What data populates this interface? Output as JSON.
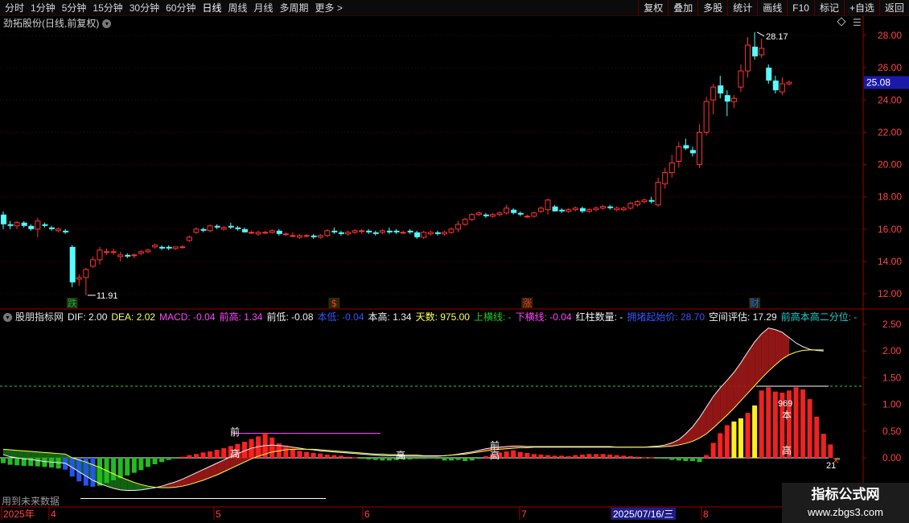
{
  "toolbar": {
    "periods": [
      "分时",
      "1分钟",
      "5分钟",
      "15分钟",
      "30分钟",
      "60分钟",
      "日线",
      "周线",
      "月线",
      "多周期",
      "更多 >"
    ],
    "active_period": "日线",
    "buttons": [
      "复权",
      "叠加",
      "多股",
      "统计",
      "画线",
      "F10",
      "标记",
      "+自选",
      "返回"
    ]
  },
  "stock": {
    "title": "劲拓股份(日线,前复权)"
  },
  "price_axis": {
    "labels": [
      "28.00",
      "26.00",
      "24.00",
      "22.00",
      "20.00",
      "18.00",
      "16.00",
      "14.00",
      "12.00"
    ],
    "current_price": "25.08",
    "high_label": "28.17",
    "low_label": "11.91"
  },
  "event_markers": [
    {
      "text": "跌",
      "color": "#00b050"
    },
    {
      "text": "$",
      "color": "#ff3030"
    },
    {
      "text": "涨",
      "color": "#ff3030"
    },
    {
      "text": "财",
      "color": "#2266ff"
    }
  ],
  "indicator": {
    "items": [
      {
        "text": "股朋指标网",
        "color": "#e0e0e0"
      },
      {
        "text": "DIF: 2.00",
        "color": "#f0f0f0"
      },
      {
        "text": "DEA: 2.02",
        "color": "#ffff55"
      },
      {
        "text": "MACD: -0.04",
        "color": "#ff44ff"
      },
      {
        "text": "前高: 1.34",
        "color": "#ff44ff"
      },
      {
        "text": "前低: -0.08",
        "color": "#f0f0f0"
      },
      {
        "text": "本低: -0.04",
        "color": "#3355ff"
      },
      {
        "text": "本高: 1.34",
        "color": "#f0f0f0"
      },
      {
        "text": "天数: 975.00",
        "color": "#ffff55"
      },
      {
        "text": "上横线: -",
        "color": "#22cc22"
      },
      {
        "text": "下横线: -0.04",
        "color": "#ff44ff"
      },
      {
        "text": "红柱数量: -",
        "color": "#f0f0f0"
      },
      {
        "text": "拥堵起始价: 28.70",
        "color": "#3355ff"
      },
      {
        "text": "空间评估: 17.29",
        "color": "#f0f0f0"
      },
      {
        "text": "前高本高二分位: -",
        "color": "#22cccc"
      }
    ],
    "axis_labels": [
      "2.50",
      "2.00",
      "1.50",
      "1.00",
      "0.50",
      "0.00"
    ],
    "annotations": {
      "qian": "前",
      "gao": "高",
      "ben": "本",
      "value_969": "969",
      "value_21": "21"
    }
  },
  "future_note": "用到未来数据",
  "date_axis": {
    "labels": [
      "2025年",
      "4",
      "5",
      "6",
      "7",
      "2025/07/16/三",
      "8"
    ]
  },
  "watermark": {
    "name": "指标公式网",
    "url": "www.zbgs3.com"
  },
  "colors": {
    "up": "#ff3333",
    "down": "#54ffff",
    "grid": "#5a0000",
    "axis": "#a00000"
  },
  "chart_data": {
    "type": "candlestick",
    "price_range": [
      11.5,
      28.8
    ],
    "candles": [
      [
        16.9,
        17.1,
        16.0,
        16.3
      ],
      [
        16.3,
        16.5,
        16.0,
        16.2
      ],
      [
        16.2,
        16.5,
        16.0,
        16.4
      ],
      [
        16.4,
        16.5,
        16.1,
        16.2
      ],
      [
        16.2,
        16.3,
        15.9,
        16.0
      ],
      [
        16.0,
        16.7,
        15.5,
        16.5
      ],
      [
        16.3,
        16.4,
        16.1,
        16.2
      ],
      [
        16.1,
        16.2,
        15.9,
        16.0
      ],
      [
        15.9,
        16.1,
        15.8,
        16.0
      ],
      [
        15.9,
        16.0,
        15.7,
        15.8
      ],
      [
        14.9,
        15.0,
        12.4,
        12.7
      ],
      [
        12.9,
        13.2,
        12.5,
        13.0
      ],
      [
        13.0,
        13.6,
        11.9,
        13.5
      ],
      [
        13.7,
        14.3,
        13.6,
        14.1
      ],
      [
        14.1,
        14.9,
        13.8,
        14.7
      ],
      [
        14.6,
        14.8,
        14.4,
        14.6
      ],
      [
        14.6,
        14.8,
        14.4,
        14.6
      ],
      [
        14.3,
        14.6,
        14.0,
        14.4
      ],
      [
        14.4,
        14.5,
        14.2,
        14.3
      ],
      [
        14.4,
        14.5,
        14.2,
        14.4
      ],
      [
        14.5,
        14.7,
        14.4,
        14.6
      ],
      [
        14.6,
        14.8,
        14.5,
        14.7
      ],
      [
        14.9,
        15.1,
        14.8,
        15.0
      ],
      [
        14.9,
        15.0,
        14.7,
        14.8
      ],
      [
        14.9,
        15.0,
        14.7,
        14.8
      ],
      [
        14.8,
        14.9,
        14.7,
        14.9
      ],
      [
        14.9,
        15.0,
        14.8,
        14.9
      ],
      [
        15.3,
        15.6,
        15.2,
        15.5
      ],
      [
        15.8,
        16.1,
        15.7,
        16.0
      ],
      [
        16.0,
        16.1,
        15.8,
        15.9
      ],
      [
        15.9,
        16.3,
        15.8,
        16.2
      ],
      [
        16.2,
        16.3,
        16.0,
        16.1
      ],
      [
        16.0,
        16.2,
        15.9,
        16.1
      ],
      [
        16.2,
        16.4,
        16.0,
        16.1
      ],
      [
        16.1,
        16.2,
        15.9,
        16.0
      ],
      [
        16.0,
        16.1,
        15.8,
        15.8
      ],
      [
        15.8,
        15.9,
        15.7,
        15.8
      ],
      [
        15.7,
        15.9,
        15.6,
        15.8
      ],
      [
        15.8,
        15.9,
        15.7,
        15.8
      ],
      [
        15.8,
        16.0,
        15.7,
        15.9
      ],
      [
        15.9,
        16.0,
        15.6,
        15.7
      ],
      [
        15.7,
        15.8,
        15.6,
        15.7
      ],
      [
        15.6,
        15.8,
        15.5,
        15.6
      ],
      [
        15.5,
        15.7,
        15.4,
        15.6
      ],
      [
        15.6,
        15.7,
        15.5,
        15.6
      ],
      [
        15.6,
        15.7,
        15.4,
        15.5
      ],
      [
        15.5,
        15.7,
        15.4,
        15.6
      ],
      [
        15.6,
        16.0,
        15.5,
        15.9
      ],
      [
        15.9,
        16.1,
        15.7,
        15.8
      ],
      [
        15.8,
        15.9,
        15.6,
        15.7
      ],
      [
        15.7,
        15.9,
        15.6,
        15.8
      ],
      [
        15.8,
        16.0,
        15.7,
        15.9
      ],
      [
        15.9,
        16.0,
        15.7,
        15.9
      ],
      [
        15.9,
        16.0,
        15.7,
        15.8
      ],
      [
        15.8,
        15.9,
        15.6,
        15.7
      ],
      [
        15.8,
        16.0,
        15.7,
        15.9
      ],
      [
        15.9,
        16.1,
        15.7,
        15.8
      ],
      [
        15.9,
        16.0,
        15.7,
        15.8
      ],
      [
        15.8,
        15.9,
        15.7,
        15.8
      ],
      [
        15.9,
        16.0,
        15.7,
        15.8
      ],
      [
        15.8,
        15.9,
        15.4,
        15.5
      ],
      [
        15.5,
        15.9,
        15.4,
        15.8
      ],
      [
        15.7,
        15.9,
        15.6,
        15.8
      ],
      [
        15.8,
        15.9,
        15.6,
        15.7
      ],
      [
        15.7,
        15.9,
        15.6,
        15.8
      ],
      [
        15.8,
        16.1,
        15.7,
        16.0
      ],
      [
        16.0,
        16.5,
        15.8,
        16.3
      ],
      [
        16.3,
        16.7,
        16.2,
        16.6
      ],
      [
        16.6,
        17.0,
        16.5,
        16.9
      ],
      [
        16.9,
        17.1,
        16.8,
        17.0
      ],
      [
        16.9,
        17.0,
        16.7,
        16.8
      ],
      [
        16.8,
        17.0,
        16.7,
        16.9
      ],
      [
        16.9,
        17.1,
        16.8,
        17.0
      ],
      [
        17.0,
        17.5,
        16.9,
        17.3
      ],
      [
        17.2,
        17.3,
        16.9,
        17.0
      ],
      [
        17.0,
        17.1,
        16.8,
        16.9
      ],
      [
        16.8,
        16.9,
        16.7,
        16.8
      ],
      [
        16.8,
        17.1,
        16.7,
        17.0
      ],
      [
        17.1,
        17.4,
        17.0,
        17.3
      ],
      [
        17.2,
        17.9,
        16.9,
        17.8
      ],
      [
        17.4,
        17.5,
        17.1,
        17.1
      ],
      [
        17.2,
        17.3,
        17.0,
        17.1
      ],
      [
        17.1,
        17.3,
        17.0,
        17.2
      ],
      [
        17.2,
        17.4,
        17.1,
        17.3
      ],
      [
        17.3,
        17.4,
        17.0,
        17.1
      ],
      [
        17.1,
        17.3,
        17.0,
        17.2
      ],
      [
        17.2,
        17.4,
        17.1,
        17.3
      ],
      [
        17.3,
        17.5,
        17.2,
        17.4
      ],
      [
        17.4,
        17.5,
        17.2,
        17.3
      ],
      [
        17.2,
        17.4,
        17.1,
        17.3
      ],
      [
        17.2,
        17.4,
        17.1,
        17.3
      ],
      [
        17.3,
        17.7,
        17.2,
        17.6
      ],
      [
        17.5,
        17.8,
        17.4,
        17.7
      ],
      [
        17.7,
        17.9,
        17.6,
        17.8
      ],
      [
        17.8,
        18.0,
        17.6,
        17.7
      ],
      [
        17.5,
        19.2,
        17.4,
        18.9
      ],
      [
        18.8,
        19.8,
        18.5,
        19.5
      ],
      [
        19.5,
        20.6,
        19.2,
        20.1
      ],
      [
        20.2,
        21.4,
        19.8,
        21.1
      ],
      [
        21.2,
        21.6,
        20.9,
        21.0
      ],
      [
        20.9,
        21.1,
        20.5,
        20.7
      ],
      [
        20.0,
        22.5,
        19.8,
        22.0
      ],
      [
        22.0,
        24.2,
        21.8,
        23.9
      ],
      [
        24.0,
        25.0,
        23.1,
        24.8
      ],
      [
        24.9,
        25.5,
        24.1,
        24.4
      ],
      [
        24.3,
        24.6,
        23.0,
        23.9
      ],
      [
        23.9,
        24.3,
        23.5,
        24.1
      ],
      [
        24.8,
        26.2,
        24.5,
        25.8
      ],
      [
        25.8,
        27.9,
        25.4,
        27.4
      ],
      [
        27.3,
        28.2,
        26.5,
        26.7
      ],
      [
        26.8,
        27.8,
        26.6,
        27.2
      ],
      [
        26.0,
        26.2,
        25.0,
        25.2
      ],
      [
        25.2,
        25.5,
        24.4,
        24.6
      ],
      [
        24.5,
        25.4,
        24.3,
        25.0
      ],
      [
        25.0,
        25.2,
        24.9,
        25.1
      ]
    ],
    "macd": [
      -0.1,
      -0.13,
      -0.14,
      -0.15,
      -0.15,
      -0.16,
      -0.17,
      -0.18,
      -0.2,
      -0.22,
      -0.35,
      -0.44,
      -0.52,
      -0.54,
      -0.52,
      -0.47,
      -0.42,
      -0.38,
      -0.33,
      -0.28,
      -0.23,
      -0.17,
      -0.12,
      -0.08,
      -0.04,
      -0.01,
      0.02,
      0.05,
      0.07,
      0.1,
      0.12,
      0.15,
      0.18,
      0.22,
      0.26,
      0.3,
      0.35,
      0.4,
      0.46,
      0.38,
      0.27,
      0.2,
      0.16,
      0.13,
      0.11,
      0.09,
      0.08,
      0.06,
      0.05,
      0.04,
      0.02,
      0.01,
      -0.02,
      -0.03,
      -0.04,
      -0.05,
      -0.05,
      -0.04,
      -0.03,
      -0.03,
      -0.02,
      -0.02,
      -0.01,
      -0.02,
      -0.05,
      -0.05,
      -0.04,
      -0.06,
      -0.05,
      -0.02,
      0.03,
      0.07,
      0.1,
      0.12,
      0.14,
      0.11,
      0.09,
      0.07,
      0.06,
      0.05,
      0.04,
      0.04,
      0.03,
      0.05,
      0.06,
      0.07,
      0.07,
      0.07,
      0.06,
      0.05,
      0.04,
      0.03,
      0.02,
      0.01,
      0.01,
      -0.01,
      -0.02,
      -0.04,
      -0.05,
      -0.06,
      -0.06,
      -0.08,
      0.05,
      0.28,
      0.46,
      0.61,
      0.68,
      0.74,
      0.84,
      0.98,
      1.26,
      1.32,
      1.24,
      1.22,
      1.26,
      1.32,
      1.28,
      1.1,
      0.77,
      0.45,
      0.25,
      -0.04
    ],
    "dif": [
      0.06,
      0.02,
      0.0,
      -0.02,
      -0.03,
      -0.05,
      -0.07,
      -0.08,
      -0.09,
      -0.1,
      -0.18,
      -0.26,
      -0.34,
      -0.42,
      -0.48,
      -0.53,
      -0.57,
      -0.6,
      -0.61,
      -0.61,
      -0.6,
      -0.58,
      -0.56,
      -0.53,
      -0.49,
      -0.45,
      -0.4,
      -0.34,
      -0.28,
      -0.22,
      -0.16,
      -0.1,
      -0.04,
      0.02,
      0.08,
      0.13,
      0.18,
      0.21,
      0.23,
      0.24,
      0.23,
      0.22,
      0.2,
      0.18,
      0.16,
      0.15,
      0.13,
      0.12,
      0.11,
      0.1,
      0.09,
      0.08,
      0.07,
      0.06,
      0.05,
      0.04,
      0.04,
      0.04,
      0.03,
      0.03,
      0.03,
      0.03,
      0.03,
      0.03,
      0.04,
      0.05,
      0.07,
      0.09,
      0.11,
      0.14,
      0.17,
      0.19,
      0.2,
      0.21,
      0.22,
      0.22,
      0.21,
      0.21,
      0.21,
      0.21,
      0.21,
      0.21,
      0.21,
      0.21,
      0.21,
      0.21,
      0.21,
      0.21,
      0.21,
      0.2,
      0.2,
      0.2,
      0.2,
      0.2,
      0.21,
      0.22,
      0.24,
      0.28,
      0.34,
      0.45,
      0.58,
      0.75,
      0.95,
      1.15,
      1.31,
      1.45,
      1.6,
      1.78,
      1.98,
      2.17,
      2.32,
      2.43,
      2.4,
      2.35,
      2.25,
      2.15,
      2.08,
      2.03,
      2.01,
      2.0
    ],
    "dea": [
      0.16,
      0.15,
      0.14,
      0.13,
      0.12,
      0.11,
      0.1,
      0.09,
      0.08,
      0.07,
      0.0,
      -0.04,
      -0.08,
      -0.13,
      -0.18,
      -0.24,
      -0.3,
      -0.36,
      -0.41,
      -0.46,
      -0.5,
      -0.53,
      -0.55,
      -0.56,
      -0.56,
      -0.55,
      -0.53,
      -0.5,
      -0.46,
      -0.42,
      -0.37,
      -0.32,
      -0.26,
      -0.2,
      -0.14,
      -0.08,
      -0.02,
      0.03,
      0.07,
      0.11,
      0.13,
      0.15,
      0.16,
      0.16,
      0.16,
      0.16,
      0.15,
      0.14,
      0.13,
      0.12,
      0.11,
      0.1,
      0.09,
      0.08,
      0.07,
      0.07,
      0.06,
      0.06,
      0.05,
      0.05,
      0.05,
      0.04,
      0.04,
      0.04,
      0.04,
      0.05,
      0.06,
      0.07,
      0.09,
      0.11,
      0.13,
      0.15,
      0.16,
      0.17,
      0.18,
      0.19,
      0.19,
      0.2,
      0.2,
      0.2,
      0.2,
      0.2,
      0.2,
      0.2,
      0.2,
      0.2,
      0.2,
      0.2,
      0.2,
      0.2,
      0.2,
      0.2,
      0.2,
      0.2,
      0.2,
      0.2,
      0.21,
      0.22,
      0.24,
      0.27,
      0.31,
      0.37,
      0.45,
      0.56,
      0.68,
      0.8,
      0.93,
      1.07,
      1.21,
      1.35,
      1.49,
      1.62,
      1.74,
      1.85,
      1.93,
      1.98,
      2.01,
      2.02,
      2.02,
      2.02
    ]
  }
}
